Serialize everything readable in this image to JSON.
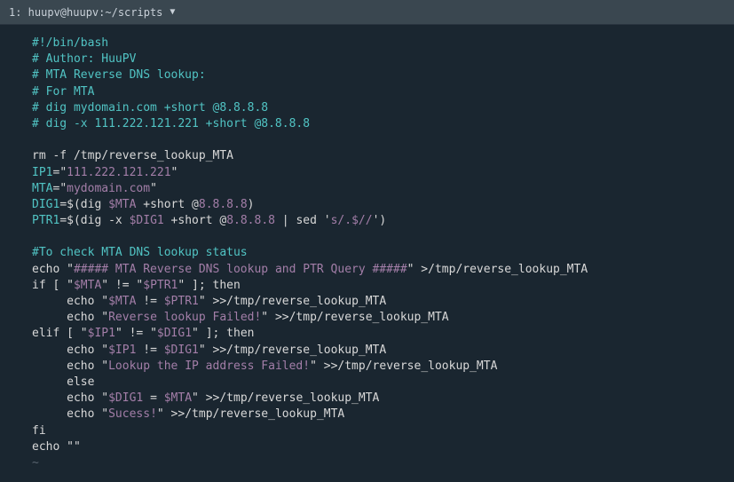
{
  "titlebar": {
    "tab": "1: huupv@huupv:~/scripts",
    "arrow": "▼"
  },
  "code": {
    "l1": "#!/bin/bash",
    "l2": "# Author: HuuPV",
    "l3": "# MTA Reverse DNS lookup:",
    "l4": "# For MTA",
    "l5": "# dig mydomain.com +short @8.8.8.8",
    "l6": "# dig -x 111.222.121.221 +short @8.8.8.8",
    "l7_cmd": "rm -f /tmp/reverse_lookup_MTA",
    "l8_var": "IP1",
    "l8_val": "111.222.121.221",
    "l9_var": "MTA",
    "l9_val": "mydomain.com",
    "l10_var": "DIG1",
    "l10_pre": "dig ",
    "l10_ref": "$MTA",
    "l10_mid": " +short @",
    "l10_ip": "8.8.8.8",
    "l11_var": "PTR1",
    "l11_pre": "dig -x ",
    "l11_ref": "$DIG1",
    "l11_mid": " +short @",
    "l11_ip": "8.8.8.8",
    "l11_sed1": " | sed '",
    "l11_sed2": "s/.$//",
    "l11_sed3": "'",
    "l12": "#To check MTA DNS lookup status",
    "l13_a": "echo ",
    "l13_b": "##### MTA Reverse DNS lookup and PTR Query #####",
    "l13_c": " >/tmp/reverse_lookup_MTA",
    "l14_a": "if [ ",
    "l14_b": "$MTA",
    "l14_c": " != ",
    "l14_d": "$PTR1",
    "l14_e": " ]; then",
    "l15_a": "     echo ",
    "l15_b": "$MTA",
    "l15_c": " != ",
    "l15_d": "$PTR1",
    "l15_e": " >>/tmp/reverse_lookup_MTA",
    "l16_a": "     echo ",
    "l16_b": "Reverse lookup Failed!",
    "l16_c": " >>/tmp/reverse_lookup_MTA",
    "l17_a": "elif [ ",
    "l17_b": "$IP1",
    "l17_c": " != ",
    "l17_d": "$DIG1",
    "l17_e": " ]; then",
    "l18_a": "     echo ",
    "l18_b": "$IP1",
    "l18_c": " != ",
    "l18_d": "$DIG1",
    "l18_e": " >>/tmp/reverse_lookup_MTA",
    "l19_a": "     echo ",
    "l19_b": "Lookup the IP address Failed!",
    "l19_c": " >>/tmp/reverse_lookup_MTA",
    "l20": "     else",
    "l21_a": "     echo ",
    "l21_b": "$DIG1",
    "l21_c": " = ",
    "l21_d": "$MTA",
    "l21_e": " >>/tmp/reverse_lookup_MTA",
    "l22_a": "     echo ",
    "l22_b": "Sucess!",
    "l22_c": " >>/tmp/reverse_lookup_MTA",
    "l23": "fi",
    "l24_a": "echo ",
    "l24_b": "",
    "tilde": "~"
  }
}
